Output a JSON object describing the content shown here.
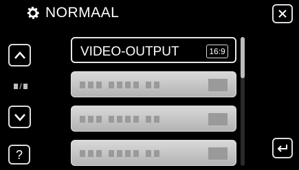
{
  "header": {
    "title": "NORMAAL",
    "icon": "gear-icon"
  },
  "controls": {
    "close": "close-icon",
    "up": "chevron-up-icon",
    "down": "chevron-down-icon",
    "help_label": "?",
    "back": "return-icon",
    "page_indicator": "/"
  },
  "menu": {
    "items": [
      {
        "label": "VIDEO-OUTPUT",
        "badge": "16:9",
        "selected": true
      },
      {
        "label": "",
        "badge": "",
        "selected": false
      },
      {
        "label": "",
        "badge": "",
        "selected": false
      },
      {
        "label": "",
        "badge": "",
        "selected": false
      }
    ]
  },
  "colors": {
    "background": "#000000",
    "button_border": "#dddddd",
    "item_fill": "#c0c0c0"
  }
}
